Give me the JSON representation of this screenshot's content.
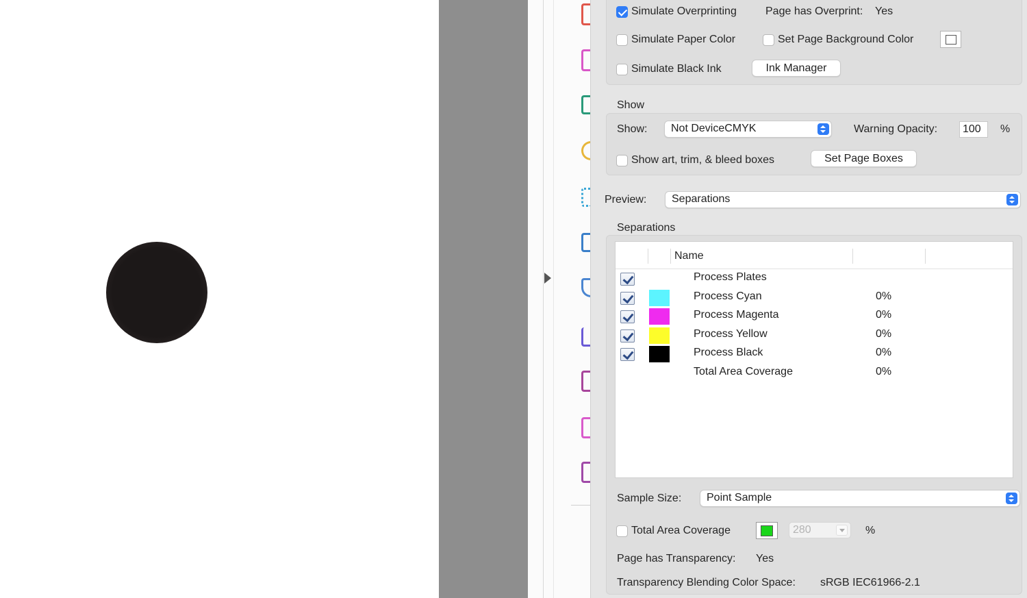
{
  "overprint": {
    "simulate_overprinting": {
      "label": "Simulate Overprinting",
      "checked": true
    },
    "page_has_overprint_label": "Page has Overprint:",
    "page_has_overprint_value": "Yes",
    "simulate_paper_color": {
      "label": "Simulate Paper Color",
      "checked": false
    },
    "set_page_background_color": {
      "label": "Set Page Background Color",
      "checked": false
    },
    "simulate_black_ink": {
      "label": "Simulate Black Ink",
      "checked": false
    },
    "ink_manager_label": "Ink Manager"
  },
  "show_section": {
    "heading": "Show",
    "show_label": "Show:",
    "show_value": "Not DeviceCMYK",
    "warning_opacity_label": "Warning Opacity:",
    "warning_opacity_value": "100",
    "percent": "%",
    "show_boxes": {
      "label": "Show art, trim, & bleed boxes",
      "checked": false
    },
    "set_page_boxes_label": "Set Page Boxes"
  },
  "preview": {
    "label": "Preview:",
    "value": "Separations"
  },
  "separations": {
    "heading": "Separations",
    "columns": [
      "",
      "",
      "Name",
      "",
      ""
    ],
    "rows": [
      {
        "checked": true,
        "swatch": null,
        "name": "Process Plates",
        "percent": ""
      },
      {
        "checked": true,
        "swatch": "#5cf4ff",
        "name": "Process Cyan",
        "percent": "0%"
      },
      {
        "checked": true,
        "swatch": "#ef2bef",
        "name": "Process Magenta",
        "percent": "0%"
      },
      {
        "checked": true,
        "swatch": "#fdfd2a",
        "name": "Process Yellow",
        "percent": "0%"
      },
      {
        "checked": true,
        "swatch": "#000000",
        "name": "Process Black",
        "percent": "0%"
      },
      {
        "checked": false,
        "swatch": null,
        "name": "Total Area Coverage",
        "percent": "0%"
      }
    ]
  },
  "sample_size": {
    "label": "Sample Size:",
    "value": "Point Sample"
  },
  "total_area_coverage": {
    "label": "Total Area Coverage",
    "checked": false,
    "value": "280",
    "percent": "%",
    "color": "#1bd61b"
  },
  "page_has_transparency": {
    "label": "Page has Transparency:",
    "value": "Yes"
  },
  "blending_space": {
    "label": "Transparency Blending Color Space:",
    "value": "sRGB IEC61966-2.1"
  },
  "colors": {
    "accent": "#2f7cf6",
    "panel_bg": "#e5e5e5",
    "gutter": "#8e8e8e"
  },
  "tool_icons": [
    "export-pdf-icon",
    "organize-pages-icon",
    "edit-pdf-icon",
    "comment-icon",
    "scan-ocr-icon",
    "print-production-icon",
    "protect-icon",
    "fill-sign-icon",
    "edit-pdf-icon-2",
    "compare-icon",
    "more-tools-icon"
  ]
}
